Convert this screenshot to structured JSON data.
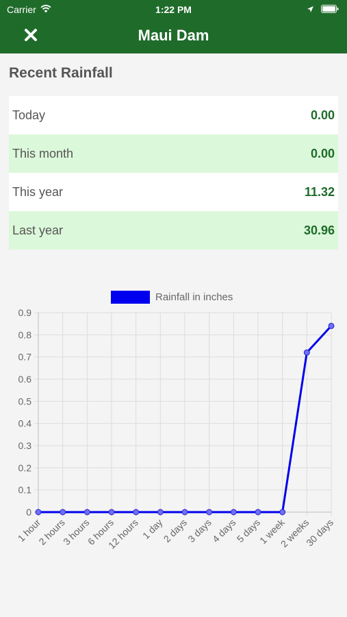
{
  "status_bar": {
    "carrier": "Carrier",
    "time": "1:22 PM"
  },
  "nav": {
    "title": "Maui Dam"
  },
  "section_title": "Recent Rainfall",
  "rows": [
    {
      "label": "Today",
      "value": "0.00"
    },
    {
      "label": "This month",
      "value": "0.00"
    },
    {
      "label": "This year",
      "value": "11.32"
    },
    {
      "label": "Last year",
      "value": "30.96"
    }
  ],
  "colors": {
    "header": "#1f6b2a",
    "value_text": "#1e6b2a",
    "alt_row": "#dcf8da",
    "series": "#0000ee"
  },
  "chart_data": {
    "type": "line",
    "legend": "Rainfall in inches",
    "categories": [
      "1 hour",
      "2 hours",
      "3 hours",
      "6 hours",
      "12 hours",
      "1 day",
      "2 days",
      "3 days",
      "4 days",
      "5 days",
      "1 week",
      "2 weeks",
      "30 days"
    ],
    "series": [
      {
        "name": "Rainfall in inches",
        "values": [
          0,
          0,
          0,
          0,
          0,
          0,
          0,
          0,
          0,
          0,
          0,
          0.72,
          0.84
        ]
      }
    ],
    "ylim": [
      0,
      0.9
    ],
    "yticks": [
      "0",
      "0.1",
      "0.2",
      "0.3",
      "0.4",
      "0.5",
      "0.6",
      "0.7",
      "0.8",
      "0.9"
    ],
    "grid": true
  }
}
